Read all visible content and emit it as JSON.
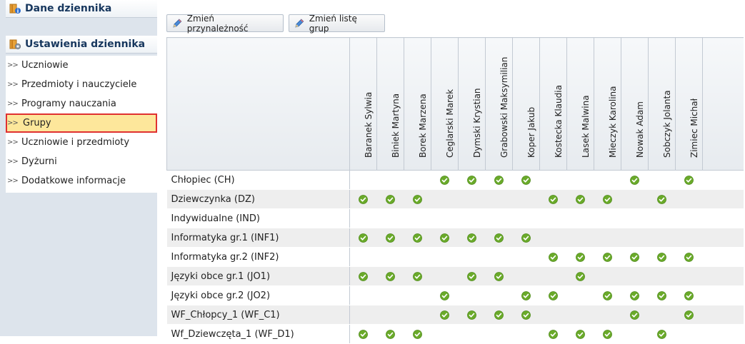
{
  "sidebar": {
    "header_dane": "Dane dziennika",
    "header_ustawienia": "Ustawienia dziennika",
    "items": [
      {
        "label": "Uczniowie",
        "selected": false
      },
      {
        "label": "Przedmioty i nauczyciele",
        "selected": false
      },
      {
        "label": "Programy nauczania",
        "selected": false
      },
      {
        "label": "Grupy",
        "selected": true
      },
      {
        "label": "Uczniowie i przedmioty",
        "selected": false
      },
      {
        "label": "Dyżurni",
        "selected": false
      },
      {
        "label": "Dodatkowe informacje",
        "selected": false
      }
    ],
    "chevron": ">>"
  },
  "toolbar": {
    "change_membership_label": "Zmień przynależność",
    "change_group_list_label": "Zmień listę grup",
    "icon": "pencil-icon"
  },
  "grid": {
    "students": [
      "Baranek Sylwia",
      "Biniek Martyna",
      "Borek Marzena",
      "Ceglarski Marek",
      "Dymski Krystian",
      "Grabowski Maksymilian",
      "Koper Jakub",
      "Kostecka Klaudia",
      "Lasek Malwina",
      "Mieczyk Karolina",
      "Nowak Adam",
      "Sobczyk Jolanta",
      "Zimiec Michał"
    ],
    "groups": [
      {
        "name": "Chłopiec (CH)",
        "members": [
          0,
          0,
          0,
          1,
          1,
          1,
          1,
          0,
          0,
          0,
          1,
          0,
          1
        ]
      },
      {
        "name": "Dziewczynka (DZ)",
        "members": [
          1,
          1,
          1,
          0,
          0,
          0,
          0,
          1,
          1,
          1,
          0,
          1,
          0
        ]
      },
      {
        "name": "Indywidualne (IND)",
        "members": [
          0,
          0,
          0,
          0,
          0,
          0,
          0,
          0,
          0,
          0,
          0,
          0,
          0
        ]
      },
      {
        "name": "Informatyka gr.1 (INF1)",
        "members": [
          1,
          1,
          1,
          1,
          1,
          1,
          1,
          0,
          0,
          0,
          0,
          0,
          0
        ]
      },
      {
        "name": "Informatyka gr.2 (INF2)",
        "members": [
          0,
          0,
          0,
          0,
          0,
          0,
          0,
          1,
          1,
          1,
          1,
          1,
          1
        ]
      },
      {
        "name": "Języki obce gr.1 (JO1)",
        "members": [
          1,
          1,
          1,
          0,
          1,
          1,
          0,
          0,
          1,
          0,
          0,
          0,
          0
        ]
      },
      {
        "name": "Języki obce gr.2 (JO2)",
        "members": [
          0,
          0,
          0,
          1,
          0,
          0,
          1,
          1,
          0,
          1,
          1,
          1,
          1
        ]
      },
      {
        "name": "WF_Chłopcy_1 (WF_C1)",
        "members": [
          0,
          0,
          0,
          1,
          1,
          1,
          1,
          0,
          0,
          0,
          1,
          0,
          1
        ]
      },
      {
        "name": "Wf_Dziewczęta_1 (WF_D1)",
        "members": [
          1,
          1,
          1,
          0,
          0,
          0,
          0,
          1,
          1,
          1,
          0,
          1,
          0
        ]
      }
    ],
    "check_icon": "check-circle-icon",
    "check_color": "#6aaa2a"
  },
  "colors": {
    "selected_bg": "#fde79b",
    "selected_border": "#e03131",
    "header_text": "#17375e"
  }
}
